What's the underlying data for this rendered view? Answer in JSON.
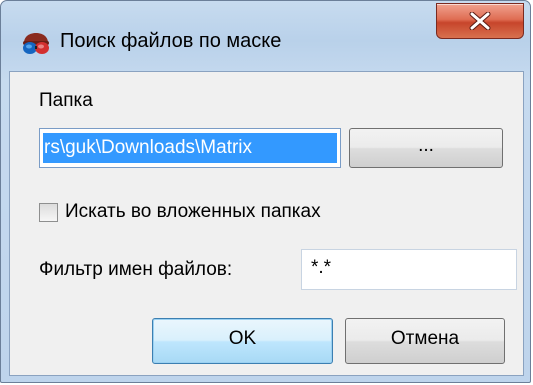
{
  "window": {
    "title": "Поиск файлов по маске",
    "icon": "glasses-icon"
  },
  "folder": {
    "label": "Папка",
    "path_value": "rs\\guk\\Downloads\\Matrix",
    "browse_label": "..."
  },
  "subfolders": {
    "label": "Искать во вложенных папках",
    "checked": false
  },
  "filter": {
    "label": "Фильтр имен файлов:",
    "value": "*.*"
  },
  "buttons": {
    "ok_label": "OK",
    "cancel_label": "Отмена"
  },
  "colors": {
    "selection": "#3399ff",
    "close_button": "#c7452b",
    "title_gradient": "#b9d1ea"
  }
}
